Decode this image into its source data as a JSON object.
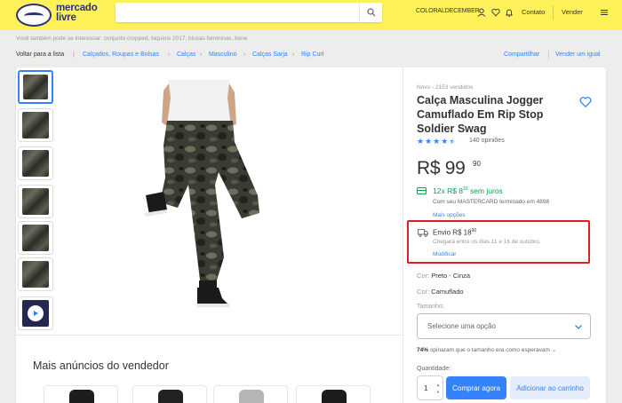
{
  "header": {
    "logo_line1": "mercado",
    "logo_line2": "livre",
    "search_placeholder": "",
    "user": "COLORALDECEMBER",
    "contato": "Contato",
    "vender": "Vender",
    "bg_color": "#fff159"
  },
  "suggestions": "Você também pode se interessar: conjunto cropped, biquinis 2017, blusas femininas, bone",
  "breadcrumb": {
    "back": "Voltar para a lista",
    "items": [
      "Calçados, Roupas e Bolsas",
      "Calças",
      "Masculino",
      "Calças Sarja",
      "Rip Curl"
    ]
  },
  "actions": {
    "share": "Compartilhar",
    "sell_same": "Vender um igual"
  },
  "product": {
    "condition": "Novo  -  2153 vendidos",
    "title": "Calça Masculina Jogger Camuflado Em Rip Stop Soldier Swag",
    "rating": 4.5,
    "reviews": "140 opiniões",
    "price_currency": "R$",
    "price_int": "99",
    "price_cents": "90",
    "installments_prefix": "12x R$ 8",
    "installments_cents": "33",
    "installments_suffix": " sem juros",
    "installments_sub": "Com seu MASTERCARD terminado em 4898",
    "more_options": "Mais opções",
    "shipping_prefix": "Envio R$ 18",
    "shipping_cents": "90",
    "shipping_sub": "Chegará entre os dias 11 e 16 de outubro.",
    "modify": "Modificar",
    "color_label": "Cor: ",
    "color_value": "Preto - Cinza",
    "color2_label": "Cor: ",
    "color2_value": "Camuflado",
    "size_label": "Tamanho:",
    "size_placeholder": "Selecione uma opção",
    "size_pct": "74%",
    "size_text": " opinaram que o tamanho era como esperavam",
    "qty_label": "Quantidade:",
    "qty_value": "1",
    "buy": "Comprar agora",
    "add_cart": "Adicionar ao carrinho"
  },
  "more_section": {
    "title": "Mais anúncios do vendedor"
  },
  "colors": {
    "accent": "#3483fa",
    "success": "#00a650",
    "highlight_box": "#e31b23"
  }
}
